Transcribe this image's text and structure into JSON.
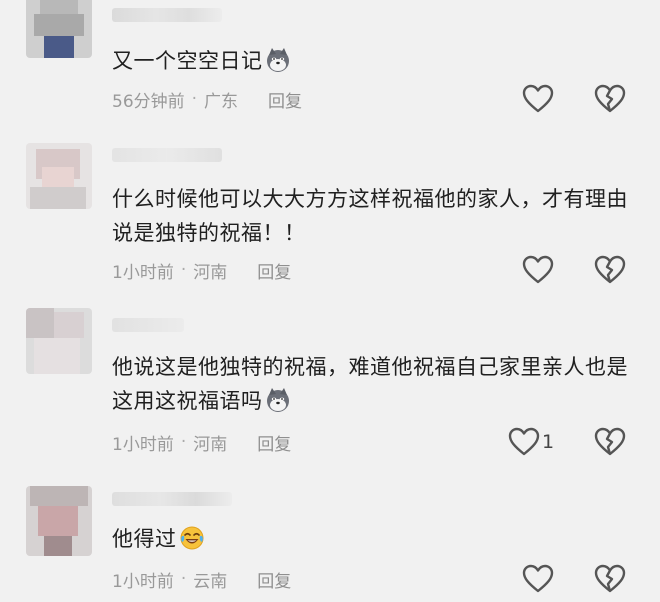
{
  "colors": {
    "background": "#f1f1f1",
    "text": "#202020",
    "meta": "#999999",
    "icon": "#555555"
  },
  "comments": [
    {
      "text": "又一个空空日记",
      "emoji": "husky-emoji",
      "time": "56分钟前",
      "location": "广东",
      "reply_label": "回复",
      "like_count": ""
    },
    {
      "text": "什么时候他可以大大方方这样祝福他的家人，才有理由说是独特的祝福！！",
      "emoji": "",
      "time": "1小时前",
      "location": "河南",
      "reply_label": "回复",
      "like_count": ""
    },
    {
      "text": "他说这是他独特的祝福，难道他祝福自己家里亲人也是这用这祝福语吗",
      "emoji": "husky-emoji",
      "time": "1小时前",
      "location": "河南",
      "reply_label": "回复",
      "like_count": "1"
    },
    {
      "text": "他得过",
      "emoji": "laughing-crying-emoji",
      "time": "1小时前",
      "location": "云南",
      "reply_label": "回复",
      "like_count": ""
    }
  ],
  "separator": "·"
}
